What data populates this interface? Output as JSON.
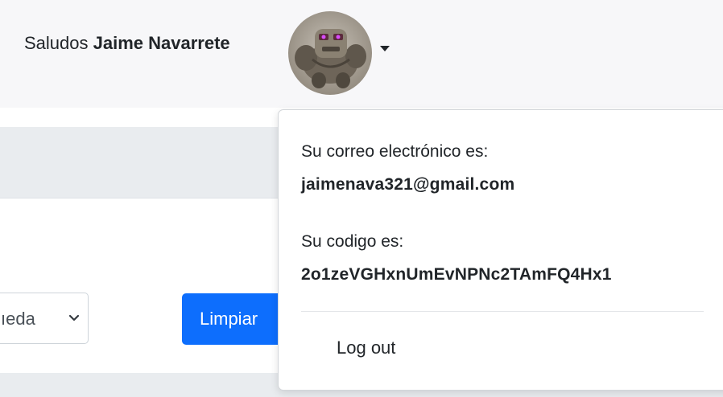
{
  "header": {
    "greeting_prefix": "Saludos",
    "user_name": "Jaime Navarrete",
    "avatar_icon": "user-avatar",
    "caret_icon": "caret-down-icon"
  },
  "filters": {
    "select_value_partial": "ıeda",
    "select_icon": "chevron-down-icon",
    "clear_button_label": "Limpiar",
    "button_color": "#0d6efd"
  },
  "user_menu": {
    "email_label": "Su correo electrónico es:",
    "email_value": "jaimenava321@gmail.com",
    "code_label": "Su codigo es:",
    "code_value": "2o1zeVGHxnUmEvNPNc2TAmFQ4Hx1",
    "logout_label": "Log out"
  }
}
